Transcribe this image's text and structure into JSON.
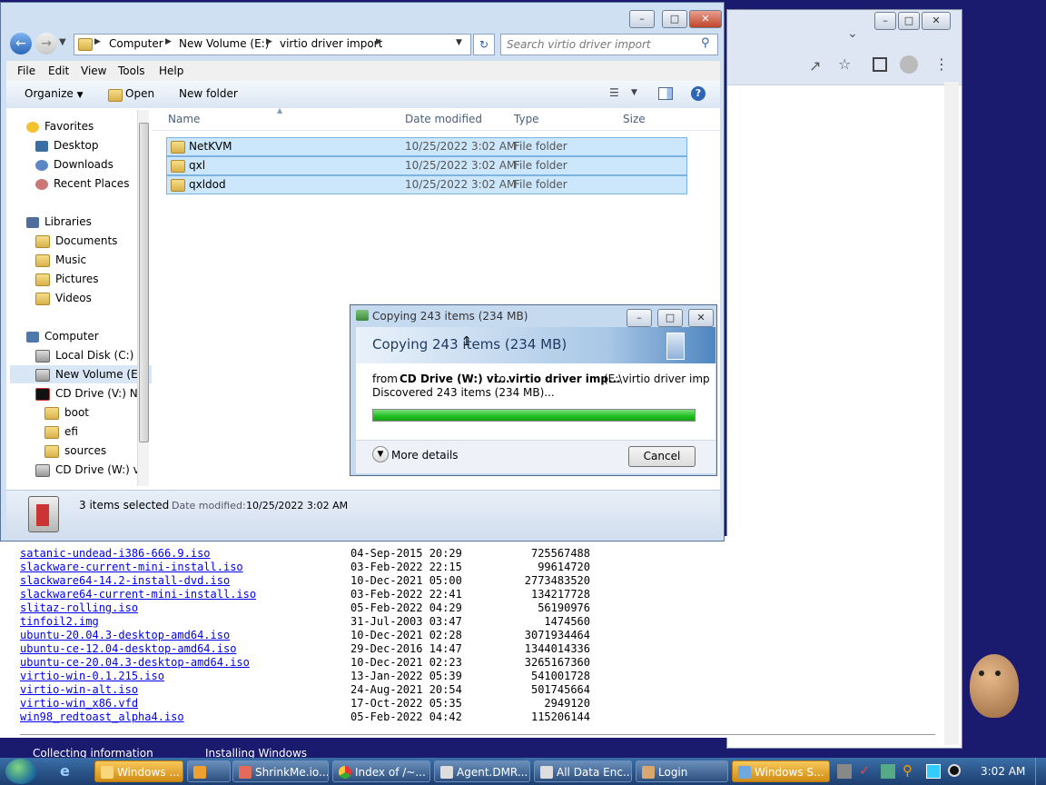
{
  "explorer": {
    "breadcrumb": [
      "Computer",
      "New Volume (E:)",
      "virtio driver import"
    ],
    "search_placeholder": "Search virtio driver import",
    "menu": [
      "File",
      "Edit",
      "View",
      "Tools",
      "Help"
    ],
    "toolbar": {
      "organize": "Organize",
      "open": "Open",
      "new_folder": "New folder"
    },
    "nav": {
      "favorites": "Favorites",
      "desktop": "Desktop",
      "downloads": "Downloads",
      "recent": "Recent Places",
      "libraries": "Libraries",
      "documents": "Documents",
      "music": "Music",
      "pictures": "Pictures",
      "videos": "Videos",
      "computer": "Computer",
      "local_disk": "Local Disk (C:)",
      "new_volume": "New Volume (E:)",
      "cd_v": "CD Drive (V:) Nex",
      "boot": "boot",
      "efi": "efi",
      "sources": "sources",
      "cd_w": "CD Drive (W:) virt"
    },
    "columns": {
      "name": "Name",
      "date": "Date modified",
      "type": "Type",
      "size": "Size"
    },
    "files": [
      {
        "name": "NetKVM",
        "date": "10/25/2022 3:02 AM",
        "type": "File folder"
      },
      {
        "name": "qxl",
        "date": "10/25/2022 3:02 AM",
        "type": "File folder"
      },
      {
        "name": "qxldod",
        "date": "10/25/2022 3:02 AM",
        "type": "File folder"
      }
    ],
    "status": {
      "selected": "3 items selected",
      "date_label": "Date modified:",
      "date_value": "10/25/2022 3:02 AM"
    }
  },
  "dialog": {
    "title": "Copying 243 items (234 MB)",
    "heading": "Copying 243 items (234 MB)",
    "from_label": "from",
    "from_value": "CD Drive (W:) vi...",
    "to_label": "to",
    "to_value": "virtio driver imp...",
    "to_path": "(E:\\virtio driver imp",
    "discovered": "Discovered 243 items (234 MB)...",
    "progress": 1.0,
    "more_details": "More details",
    "cancel": "Cancel"
  },
  "listing": [
    {
      "name": "satanic-undead-i386-666.9.iso",
      "date": "04-Sep-2015 20:29",
      "size": "725567488"
    },
    {
      "name": "slackware-current-mini-install.iso",
      "date": "03-Feb-2022 22:15",
      "size": "99614720"
    },
    {
      "name": "slackware64-14.2-install-dvd.iso",
      "date": "10-Dec-2021 05:00",
      "size": "2773483520"
    },
    {
      "name": "slackware64-current-mini-install.iso",
      "date": "03-Feb-2022 22:41",
      "size": "134217728"
    },
    {
      "name": "slitaz-rolling.iso",
      "date": "05-Feb-2022 04:29",
      "size": "56190976"
    },
    {
      "name": "tinfoil2.img",
      "date": "31-Jul-2003 03:47",
      "size": "1474560"
    },
    {
      "name": "ubuntu-20.04.3-desktop-amd64.iso",
      "date": "10-Dec-2021 02:28",
      "size": "3071934464"
    },
    {
      "name": "ubuntu-ce-12.04-desktop-amd64.iso",
      "date": "29-Dec-2016 14:47",
      "size": "1344014336"
    },
    {
      "name": "ubuntu-ce-20.04.3-desktop-amd64.iso",
      "date": "10-Dec-2021 02:23",
      "size": "3265167360"
    },
    {
      "name": "virtio-win-0.1.215.iso",
      "date": "13-Jan-2022 05:39",
      "size": "541001728"
    },
    {
      "name": "virtio-win-alt.iso",
      "date": "24-Aug-2021 20:54",
      "size": "501745664"
    },
    {
      "name": "virtio-win_x86.vfd",
      "date": "17-Oct-2022 05:35",
      "size": "2949120"
    },
    {
      "name": "win98_redtoast_alpha4.iso",
      "date": "05-Feb-2022 04:42",
      "size": "115206144"
    }
  ],
  "desktop_text": {
    "collecting": "Collecting information",
    "installing": "Installing Windows"
  },
  "taskbar": {
    "items": [
      "Windows ...",
      "",
      "ShrinkMe.io...",
      "Index of /~...",
      "Agent.DMR...",
      "All Data Enc...",
      "Login",
      "Windows S..."
    ],
    "clock": "3:02 AM"
  }
}
